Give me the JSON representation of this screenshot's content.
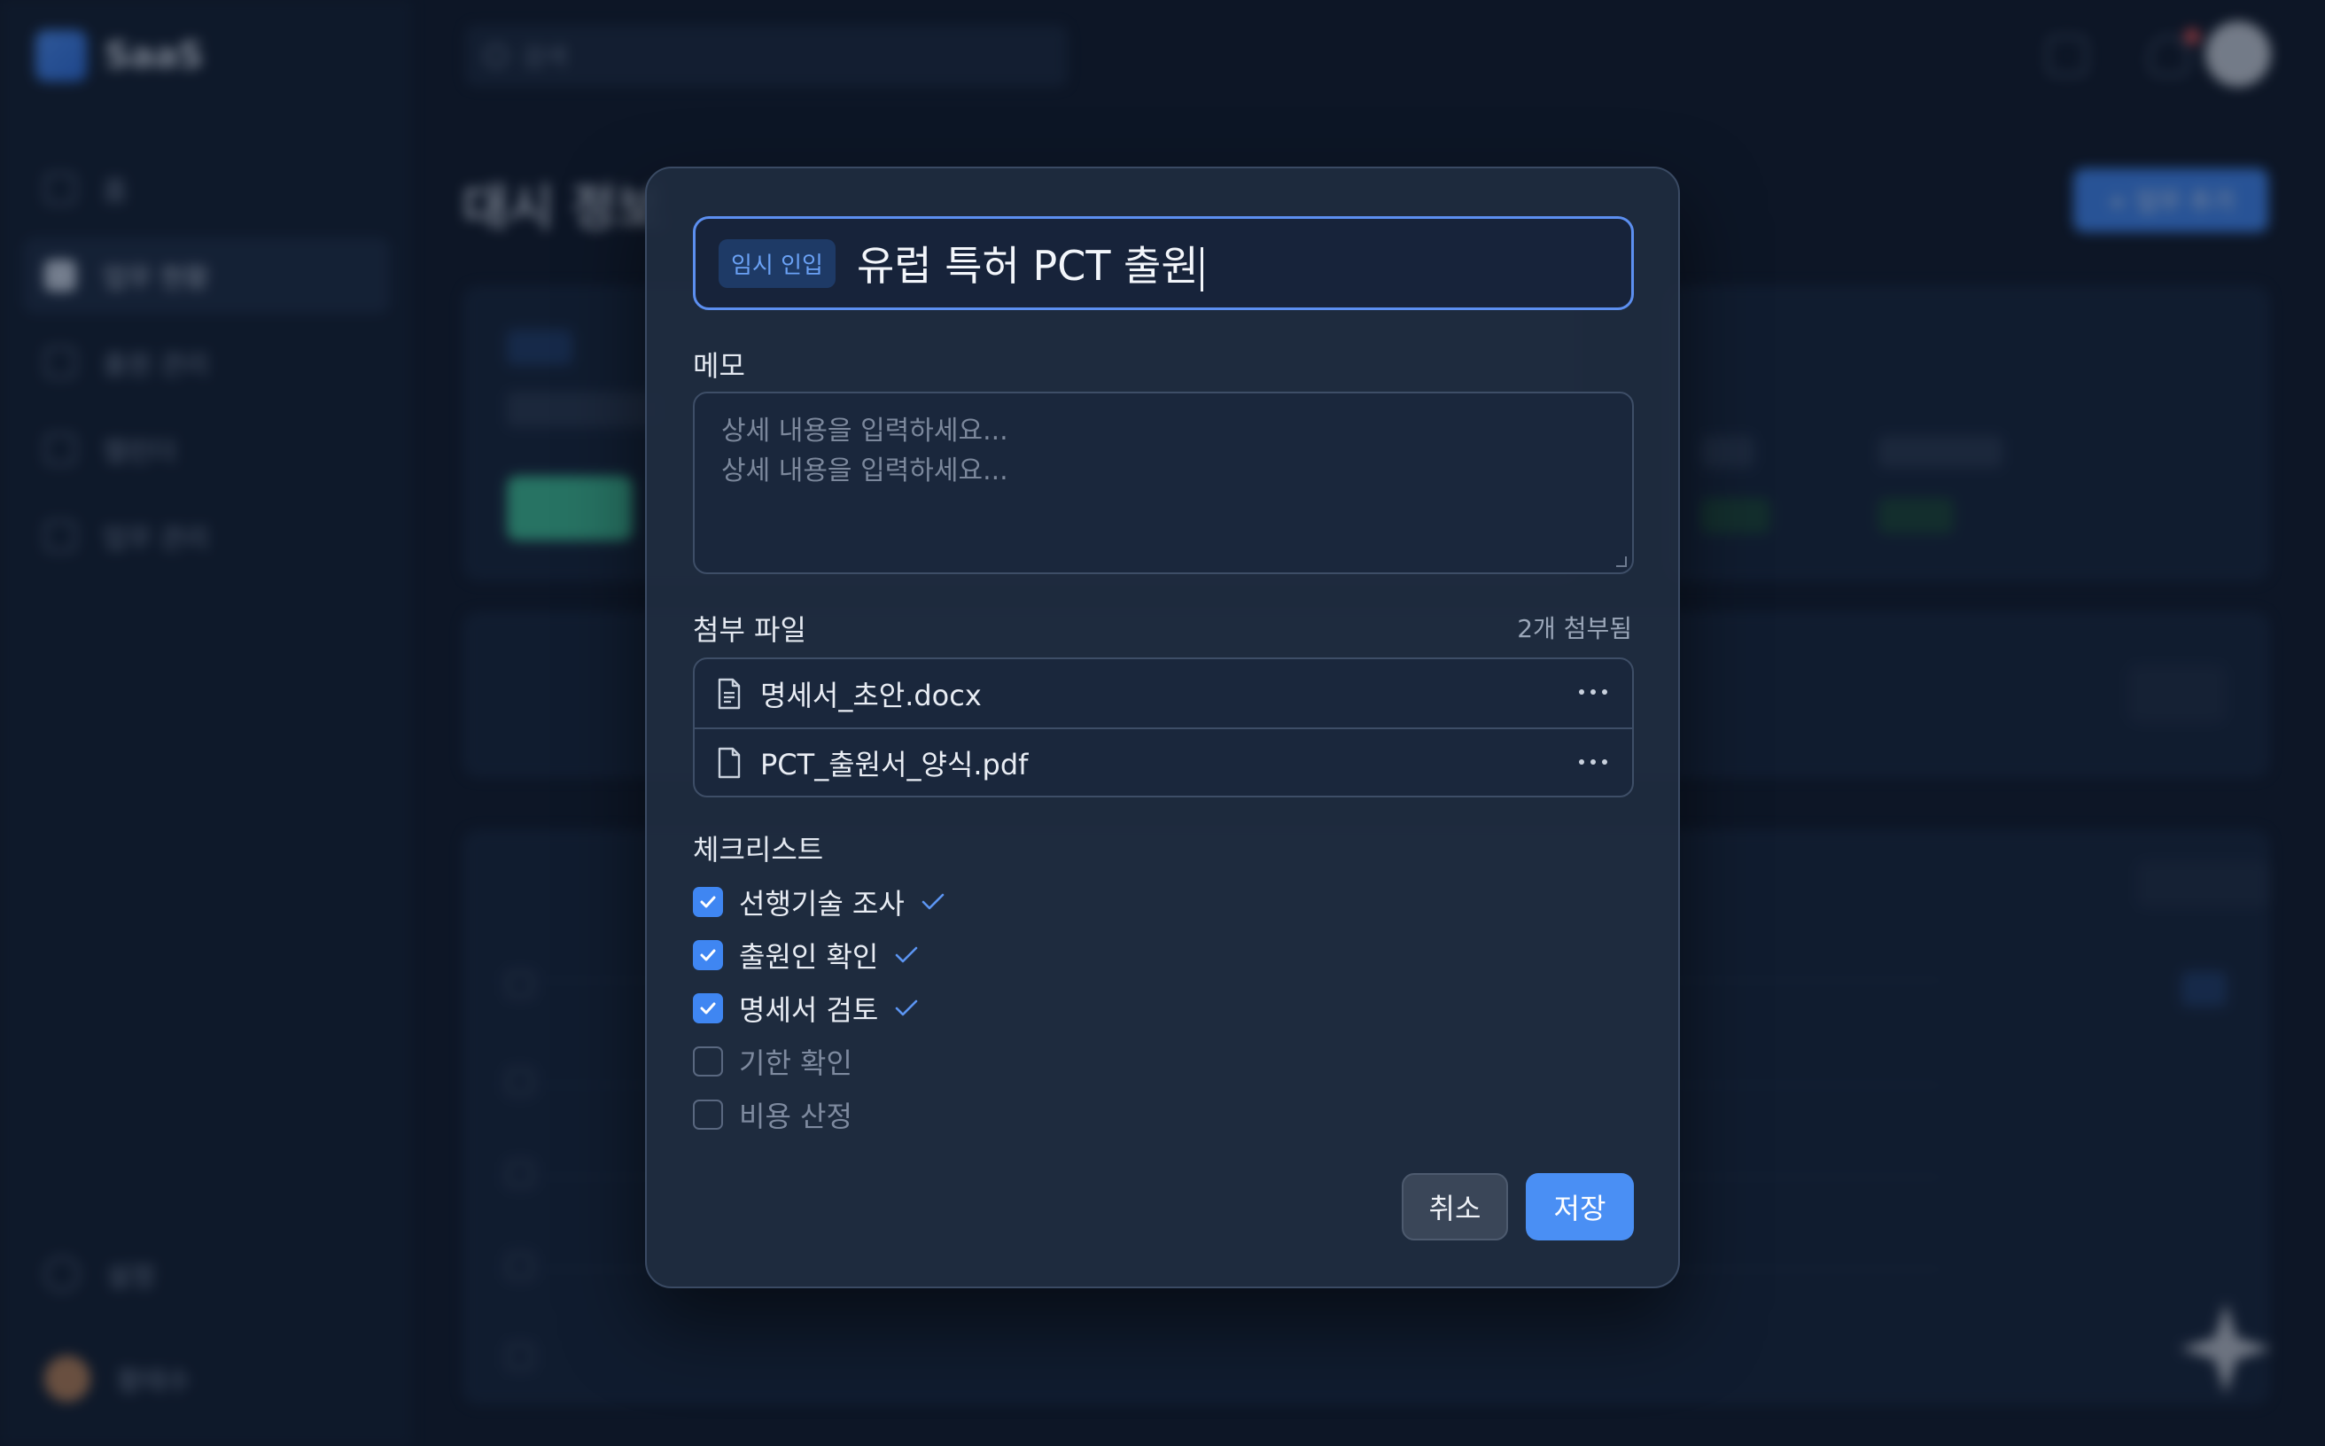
{
  "background": {
    "brand": {
      "name": "SaaS"
    },
    "sidebar": {
      "items": [
        {
          "label": "홈",
          "icon": "home-icon"
        },
        {
          "label": "업무 현황",
          "icon": "grid-icon"
        },
        {
          "label": "출원 관리",
          "icon": "document-icon"
        },
        {
          "label": "캘린더",
          "icon": "calendar-icon"
        },
        {
          "label": "업무 관리",
          "icon": "folder-icon"
        }
      ],
      "settings_label": "설정",
      "user_name": "황태수"
    },
    "search": {
      "placeholder": "검색"
    },
    "page_title": "대시 정보",
    "primary_button": "+ 업무 추가"
  },
  "modal": {
    "status_chip": "임시 인입",
    "title": "유럽 특허 PCT 출원",
    "memo": {
      "label": "메모",
      "placeholder": "상세 내용을 입력하세요...",
      "value": "상세 내용을 입력하세요..."
    },
    "attachments": {
      "label": "첨부 파일",
      "count_text": "2개 첨부됨",
      "files": [
        {
          "name": "명세서_초안.docx",
          "icon": "document-lines-icon"
        },
        {
          "name": "PCT_출원서_양식.pdf",
          "icon": "file-icon"
        }
      ]
    },
    "checklist": {
      "label": "체크리스트",
      "items": [
        {
          "label": "선행기술 조사",
          "checked": true
        },
        {
          "label": "출원인 확인",
          "checked": true
        },
        {
          "label": "명세서 검토",
          "checked": true
        },
        {
          "label": "기한 확인",
          "checked": false
        },
        {
          "label": "비용 산정",
          "checked": false
        }
      ]
    },
    "buttons": {
      "cancel": "취소",
      "save": "저장"
    }
  },
  "colors": {
    "accent": "#4a8ff4",
    "status_chip_text": "#6aa1f5",
    "modal_background": "#1f2c40",
    "page_background": "#0d1626"
  }
}
